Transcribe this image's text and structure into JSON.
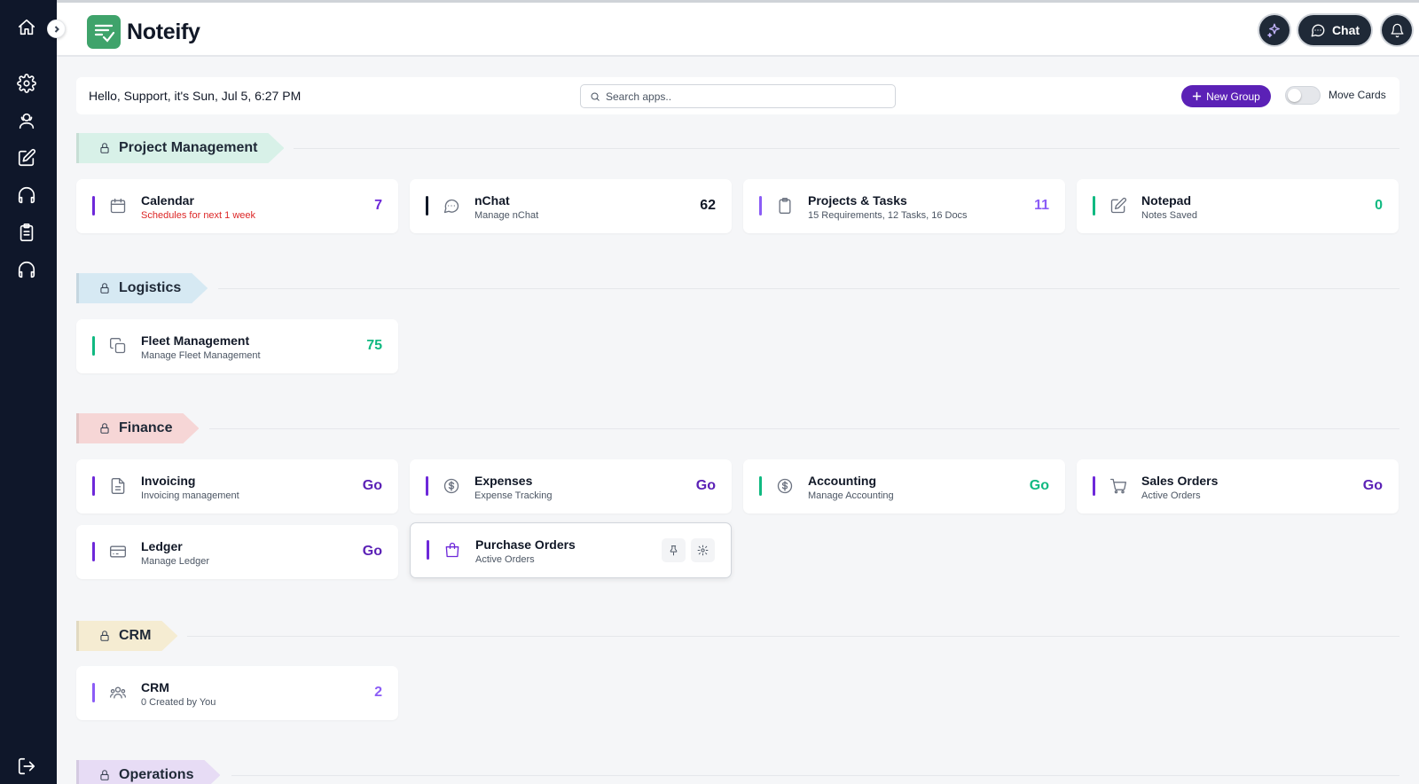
{
  "app": {
    "name": "Noteify"
  },
  "header": {
    "chat_label": "Chat"
  },
  "greeting": "Hello, Support, it's Sun, Jul 5, 6:27 PM",
  "search": {
    "placeholder": "Search apps..",
    "value": ""
  },
  "new_group_label": "New Group",
  "move_cards_label": "Move Cards",
  "move_cards_enabled": false,
  "colors": {
    "sidebar_bg": "#0f172a",
    "accent_purple": "#5b21b6",
    "count_green": "#10b981",
    "count_purple": "#7c3aed",
    "alert_red": "#dc2626"
  },
  "groups": [
    {
      "name": "Project Management",
      "tag_color": "#d8f1e8",
      "cards": [
        {
          "title": "Calendar",
          "subtitle": "Schedules for next 1 week",
          "value": "7",
          "icon": "calendar-icon",
          "bar_color": "#6d28d9",
          "value_color": "#6d28d9",
          "subtitle_color": "#dc2626"
        },
        {
          "title": "nChat",
          "subtitle": "Manage nChat",
          "value": "62",
          "icon": "message-circle-icon",
          "bar_color": "#111827",
          "value_color": "#111827"
        },
        {
          "title": "Projects & Tasks",
          "subtitle": "15 Requirements, 12 Tasks, 16 Docs",
          "value": "11",
          "icon": "clipboard-icon",
          "bar_color": "#8b5cf6",
          "value_color": "#8b5cf6"
        },
        {
          "title": "Notepad",
          "subtitle": "Notes Saved",
          "value": "0",
          "icon": "edit-icon",
          "bar_color": "#10b981",
          "value_color": "#10b981"
        }
      ]
    },
    {
      "name": "Logistics",
      "tag_color": "#d6e9f3",
      "cards": [
        {
          "title": "Fleet Management",
          "subtitle": "Manage Fleet Management",
          "value": "75",
          "icon": "copy-icon",
          "bar_color": "#10b981",
          "value_color": "#10b981"
        }
      ]
    },
    {
      "name": "Finance",
      "tag_color": "#f6d6d6",
      "cards": [
        {
          "title": "Invoicing",
          "subtitle": "Invoicing management",
          "value": "Go",
          "icon": "file-text-icon",
          "bar_color": "#6d28d9",
          "value_color": "#5b21b6"
        },
        {
          "title": "Expenses",
          "subtitle": "Expense Tracking",
          "value": "Go",
          "icon": "dollar-circle-icon",
          "bar_color": "#6d28d9",
          "value_color": "#5b21b6"
        },
        {
          "title": "Accounting",
          "subtitle": "Manage Accounting",
          "value": "Go",
          "icon": "dollar-circle-icon",
          "bar_color": "#10b981",
          "value_color": "#10b981"
        },
        {
          "title": "Sales Orders",
          "subtitle": "Active Orders",
          "value": "Go",
          "icon": "cart-icon",
          "bar_color": "#6d28d9",
          "value_color": "#5b21b6"
        },
        {
          "title": "Ledger",
          "subtitle": "Manage Ledger",
          "value": "Go",
          "icon": "credit-card-icon",
          "bar_color": "#6d28d9",
          "value_color": "#5b21b6"
        },
        {
          "title": "Purchase Orders",
          "subtitle": "Active Orders",
          "value": "",
          "icon": "shopping-bag-icon",
          "bar_color": "#6d28d9",
          "value_color": "#5b21b6"
        }
      ]
    },
    {
      "name": "CRM",
      "tag_color": "#f5ecd2",
      "cards": [
        {
          "title": "CRM",
          "subtitle": "0 Created by You",
          "value": "2",
          "icon": "users-icon",
          "bar_color": "#8b5cf6",
          "value_color": "#8b5cf6"
        }
      ]
    },
    {
      "name": "Operations",
      "tag_color": "#e7dcf5",
      "cards": []
    }
  ]
}
